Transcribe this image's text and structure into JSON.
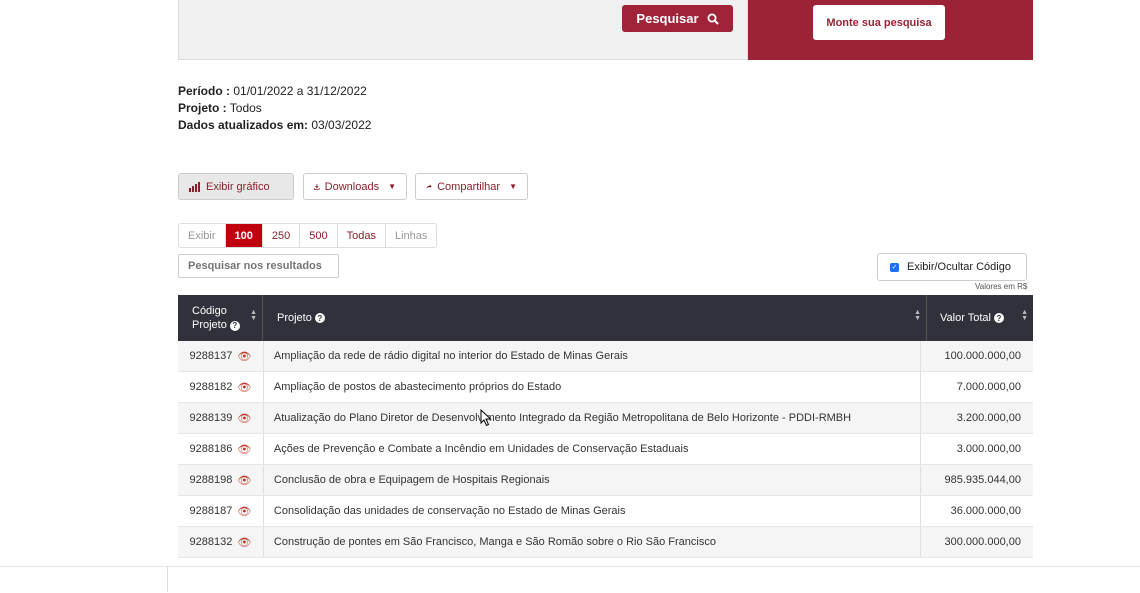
{
  "search": {
    "search_label": "Pesquisar",
    "monte_label": "Monte sua pesquisa"
  },
  "info": {
    "periodo_label": "Período :",
    "periodo_value": " 01/01/2022 a 31/12/2022",
    "projeto_label": "Projeto :",
    "projeto_value": " Todos",
    "dados_label": "Dados atualizados em:",
    "dados_value": " 03/03/2022"
  },
  "toolbar": {
    "grafico": "Exibir gráfico",
    "downloads": "Downloads",
    "compartilhar": "Compartilhar"
  },
  "pager": {
    "exibir": "Exibir",
    "p100": "100",
    "p250": "250",
    "p500": "500",
    "todas": "Todas",
    "linhas": "Linhas"
  },
  "filter": {
    "placeholder": "Pesquisar nos resultados"
  },
  "toggle_code": {
    "label": "Exibir/Ocultar Código"
  },
  "valores": "Valores em R$",
  "table": {
    "headers": {
      "codigo_1": "Código",
      "codigo_2": "Projeto",
      "projeto": "Projeto",
      "valor": "Valor Total"
    },
    "rows": [
      {
        "code": "9288137",
        "projeto": "Ampliação da rede de rádio digital no interior do Estado de Minas Gerais",
        "valor": "100.000.000,00"
      },
      {
        "code": "9288182",
        "projeto": "Ampliação de postos de abastecimento próprios do Estado",
        "valor": "7.000.000,00"
      },
      {
        "code": "9288139",
        "projeto": "Atualização do Plano Diretor de Desenvolvimento Integrado da Região Metropolitana de Belo Horizonte - PDDI-RMBH",
        "valor": "3.200.000,00"
      },
      {
        "code": "9288186",
        "projeto": "Ações de Prevenção e Combate a Incêndio em Unidades de Conservação Estaduais",
        "valor": "3.000.000,00"
      },
      {
        "code": "9288198",
        "projeto": "Conclusão de obra e Equipagem de Hospitais Regionais",
        "valor": "985.935.044,00"
      },
      {
        "code": "9288187",
        "projeto": "Consolidação das unidades de conservação no Estado de Minas Gerais",
        "valor": "36.000.000,00"
      },
      {
        "code": "9288132",
        "projeto": "Construção de pontes em São Francisco, Manga e São Romão sobre o Rio São Francisco",
        "valor": "300.000.000,00"
      }
    ]
  }
}
